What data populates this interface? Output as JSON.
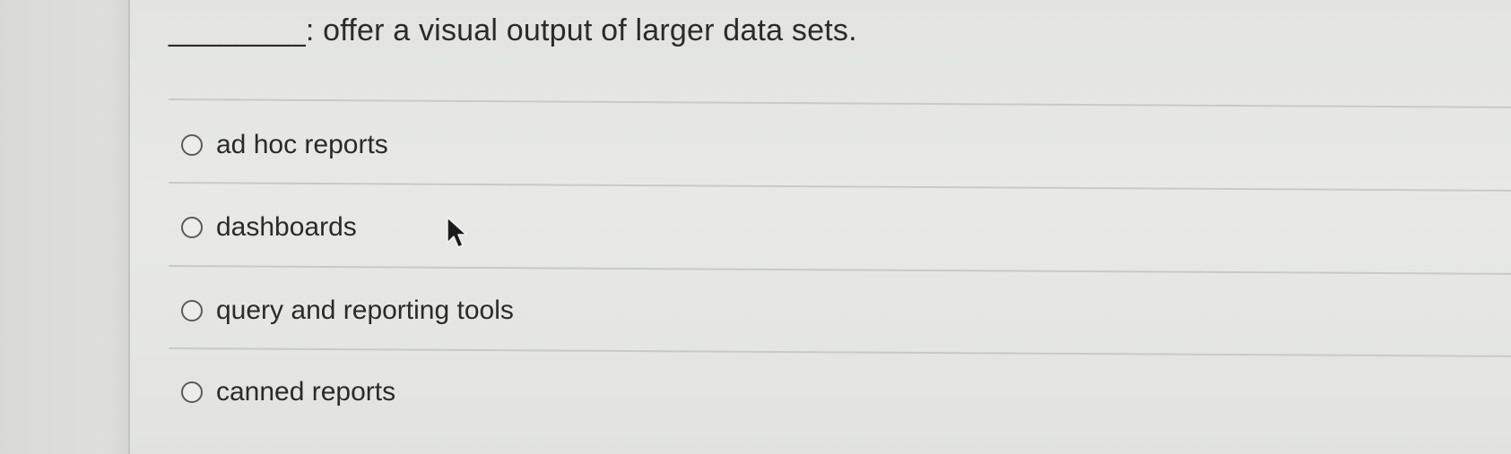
{
  "question": {
    "text": "________: offer a visual output of larger data sets."
  },
  "options": [
    {
      "label": "ad hoc reports",
      "selected": false
    },
    {
      "label": "dashboards",
      "selected": false
    },
    {
      "label": "query and reporting tools",
      "selected": false
    },
    {
      "label": "canned reports",
      "selected": false
    }
  ],
  "icons": {
    "pointer": "mouse-pointer-icon",
    "radio": "radio-circle-icon"
  },
  "colors": {
    "background": "#e6e7e5",
    "text": "#2a2a2a",
    "divider": "#c9cac8",
    "radio_border": "#5a5a5a"
  }
}
